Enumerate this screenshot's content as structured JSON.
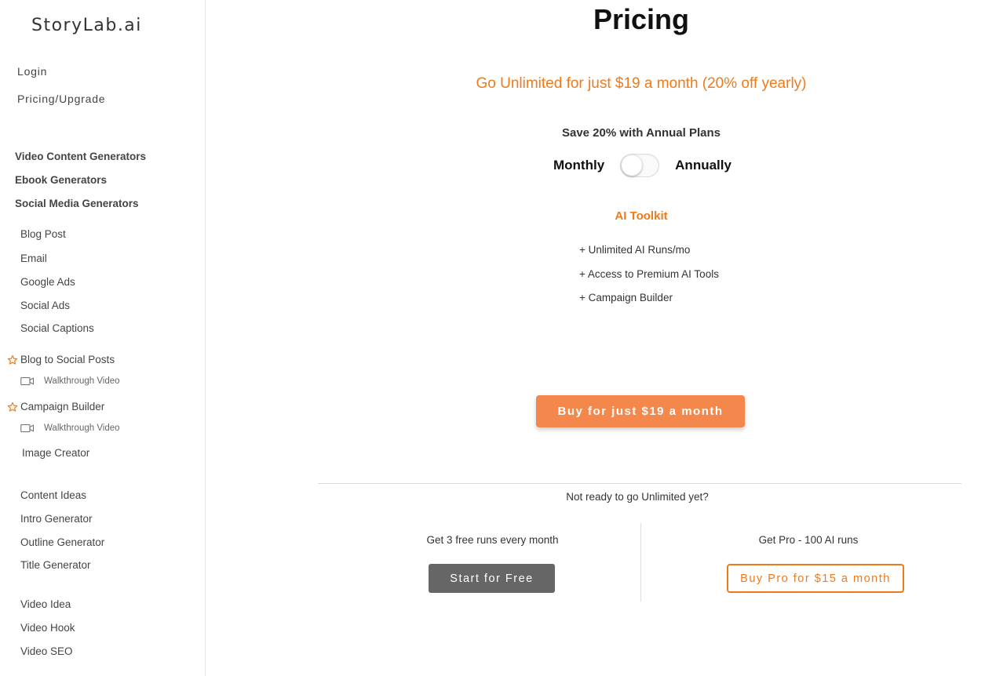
{
  "brand": {
    "logo_text": "StoryLab.ai"
  },
  "sidebar": {
    "top_links": [
      "Login",
      "Pricing/Upgrade"
    ],
    "groups": [
      "Video Content Generators",
      "Ebook Generators",
      "Social Media Generators"
    ],
    "tools": [
      "Blog Post",
      "Email",
      "Google Ads",
      "Social Ads",
      "Social Captions"
    ],
    "starred": [
      {
        "label": "Blog to Social Posts",
        "video": "Walkthrough Video"
      },
      {
        "label": "Campaign Builder",
        "video": "Walkthrough Video"
      }
    ],
    "image_creator": "Image Creator",
    "content_tools": [
      "Content Ideas",
      "Intro Generator",
      "Outline Generator",
      "Title Generator"
    ],
    "video_tools": [
      "Video Idea",
      "Video Hook",
      "Video SEO"
    ]
  },
  "pricing": {
    "title": "Pricing",
    "promo": "Go Unlimited for just $19 a month (20% off yearly)",
    "save_text": "Save 20% with Annual Plans",
    "toggle": {
      "left_label": "Monthly",
      "right_label": "Annually",
      "state": "Monthly"
    },
    "plan_name": "AI Toolkit",
    "features": [
      "+ Unlimited AI Runs/mo",
      "+ Access to Premium AI Tools",
      "+ Campaign Builder"
    ],
    "buy_button": "Buy for just $19 a month",
    "not_ready": "Not ready to go Unlimited yet?",
    "free_plan": {
      "text": "Get 3 free runs every month",
      "button": "Start for Free"
    },
    "pro_plan": {
      "text": "Get Pro - 100 AI runs",
      "button": "Buy Pro for $15 a month"
    }
  },
  "colors": {
    "accent": "#f07a1a",
    "buy_button": "#f4874b",
    "free_button": "#666666"
  }
}
